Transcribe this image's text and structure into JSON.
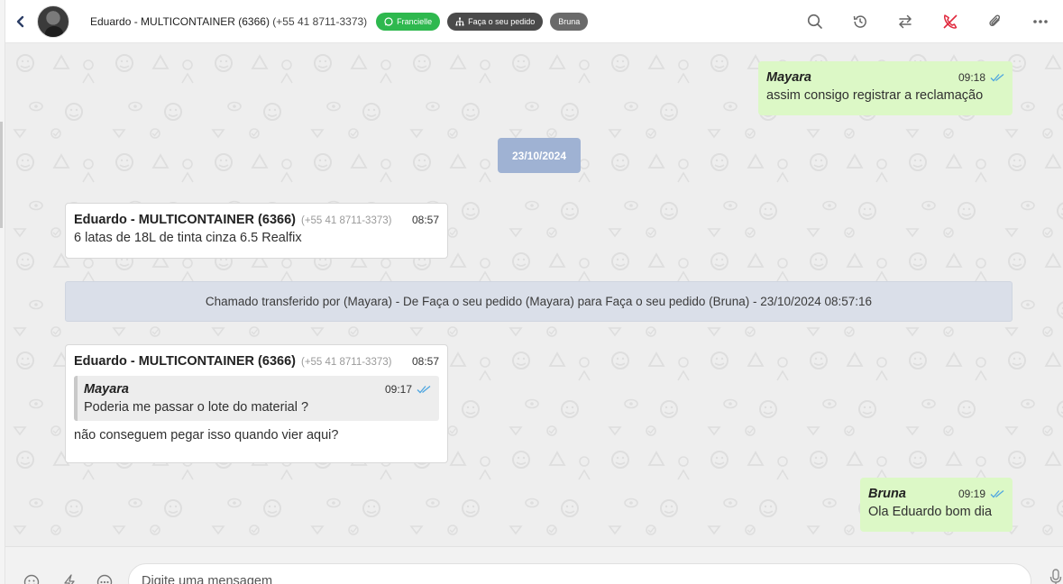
{
  "header": {
    "back_icon": "chevron-left-icon",
    "contact_name": "Eduardo - MULTICONTAINER (6366)",
    "contact_phone": "(+55 41 8711-3373)",
    "tags": [
      {
        "label": "Francielle",
        "icon": "whatsapp-icon",
        "color": "#2eb84e"
      },
      {
        "label": "Faça o seu pedido",
        "icon": "sitemap-icon",
        "color": "#4a4a4a"
      },
      {
        "label": "Bruna",
        "color": "#6a6a6a"
      }
    ],
    "actions": [
      "search-icon",
      "history-icon",
      "transfer-icon",
      "end-call-icon",
      "attachment-icon",
      "more-icon"
    ],
    "end_call_color": "#e0283c"
  },
  "messages": {
    "m1": {
      "author": "Mayara",
      "time": "09:18",
      "text": "assim consigo registrar a reclamação"
    },
    "date_separator": "23/10/2024",
    "m2": {
      "sender": "Eduardo - MULTICONTAINER (6366)",
      "phone": "(+55 41 8711-3373)",
      "time": "08:57",
      "text": "6 latas de 18L de tinta cinza 6.5 Realfix"
    },
    "system": "Chamado transferido por (Mayara) - De Faça o seu pedido (Mayara) para Faça o seu pedido (Bruna) - 23/10/2024 08:57:16",
    "m3": {
      "sender": "Eduardo - MULTICONTAINER (6366)",
      "phone": "(+55 41 8711-3373)",
      "time": "08:57",
      "quote": {
        "author": "Mayara",
        "time": "09:17",
        "text": "Poderia me passar o lote do material ?"
      },
      "text": "não conseguem pegar isso quando vier aqui?"
    },
    "m4": {
      "author": "Bruna",
      "time": "09:19",
      "text": "Ola Eduardo bom dia"
    }
  },
  "colors": {
    "outgoing_bubble": "#dcf8c6",
    "incoming_bubble": "#ffffff",
    "read_check": "#4fa6e0",
    "date_chip": "#9fb2d3",
    "system_message": "#dadfe9"
  },
  "composer": {
    "placeholder": "Digite uma mensagem",
    "icons": [
      "emoji-icon",
      "quick-reply-icon",
      "more-options-icon",
      "microphone-icon"
    ]
  }
}
